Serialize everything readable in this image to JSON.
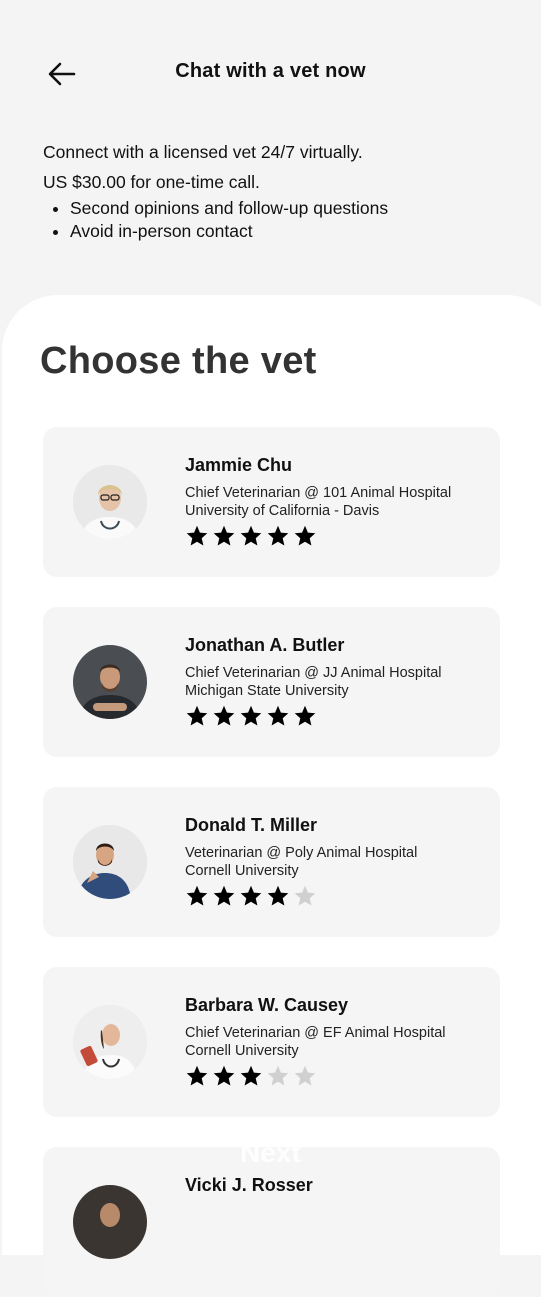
{
  "header": {
    "title": "Chat with a vet now",
    "back_icon": "arrow-left-icon"
  },
  "intro": {
    "line1": "Connect with a licensed vet 24/7 virtually.",
    "line2": "US $30.00 for one-time call.",
    "bullets": [
      "Second opinions and follow-up questions",
      "Avoid in-person contact"
    ]
  },
  "section": {
    "title": "Choose the vet"
  },
  "vets": [
    {
      "name": "Jammie Chu",
      "title": "Chief Veterinarian @ 101 Animal Hospital",
      "school": "University of California - Davis",
      "rating": 5
    },
    {
      "name": "Jonathan A. Butler",
      "title": "Chief Veterinarian @ JJ Animal Hospital",
      "school": "Michigan State University",
      "rating": 5
    },
    {
      "name": "Donald T. Miller",
      "title": "Veterinarian @ Poly Animal Hospital",
      "school": "Cornell University",
      "rating": 4
    },
    {
      "name": "Barbara W. Causey",
      "title": "Chief Veterinarian @ EF Animal Hospital",
      "school": "Cornell University",
      "rating": 3
    },
    {
      "name": "Vicki J. Rosser",
      "title": "",
      "school": "",
      "rating": null
    }
  ],
  "footer": {
    "next_label": "Next"
  },
  "colors": {
    "background": "#f4f4f4",
    "sheet": "#ffffff",
    "card": "#f5f5f5",
    "star_filled": "#000000",
    "star_empty": "#d0d0d0"
  }
}
